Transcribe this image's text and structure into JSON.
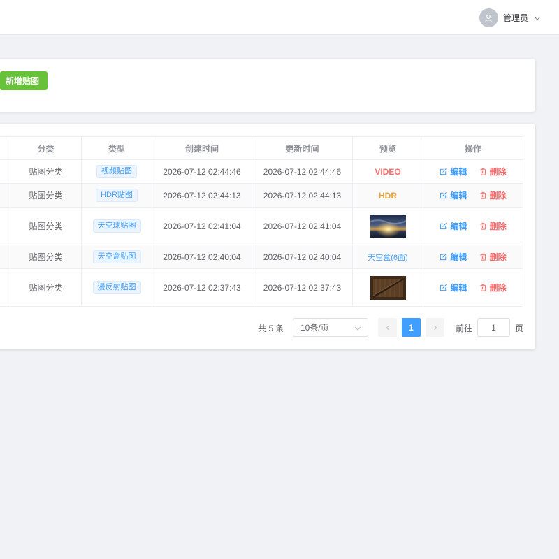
{
  "header": {
    "user_name": "管理员",
    "avatar_icon": "user-icon",
    "dropdown_icon": "chevron-down-icon"
  },
  "toolbar": {
    "add_label": "新增贴图",
    "add_color": "#67c23a"
  },
  "table": {
    "columns": {
      "category": "分类",
      "type": "类型",
      "created": "创建时间",
      "updated": "更新时间",
      "preview": "预览",
      "actions": "操作"
    },
    "rows": [
      {
        "category": "贴图分类",
        "type": "视频贴图",
        "created": "2026-07-12 02:44:46",
        "updated": "2026-07-12 02:44:46",
        "preview_text": "VIDEO",
        "edit": "编辑",
        "delete": "删除"
      },
      {
        "category": "贴图分类",
        "type": "HDR贴图",
        "created": "2026-07-12 02:44:13",
        "updated": "2026-07-12 02:44:13",
        "preview_text": "HDR",
        "edit": "编辑",
        "delete": "删除"
      },
      {
        "category": "贴图分类",
        "type": "天空球贴图",
        "created": "2026-07-12 02:41:04",
        "updated": "2026-07-12 02:41:04",
        "preview_image": "sky-sunset-thumbnail",
        "edit": "编辑",
        "delete": "删除"
      },
      {
        "category": "贴图分类",
        "type": "天空盒贴图",
        "created": "2026-07-12 02:40:04",
        "updated": "2026-07-12 02:40:04",
        "preview_text": "天空盒(6面)",
        "edit": "编辑",
        "delete": "删除"
      },
      {
        "category": "贴图分类",
        "type": "漫反射贴图",
        "created": "2026-07-12 02:37:43",
        "updated": "2026-07-12 02:37:43",
        "preview_image": "wood-crate-thumbnail",
        "edit": "编辑",
        "delete": "删除"
      }
    ]
  },
  "pagination": {
    "total": "共 5 条",
    "page_size": "10条/页",
    "current_page": "1",
    "goto_label": "前往",
    "goto_value": "1",
    "page_suffix": "页",
    "accent_color": "#409eff"
  }
}
